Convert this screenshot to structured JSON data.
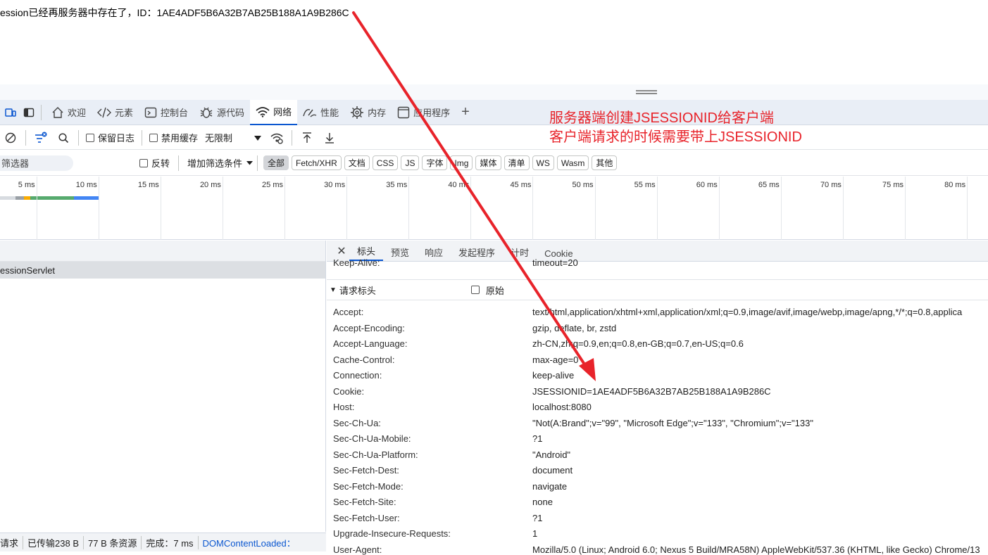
{
  "page": {
    "text": "ession已经再服务器中存在了，ID：1AE4ADF5B6A32B7AB25B188A1A9B286C"
  },
  "devtools": {
    "tabs": [
      {
        "label": "欢迎",
        "icon": "home-icon"
      },
      {
        "label": "元素",
        "icon": "code-icon"
      },
      {
        "label": "控制台",
        "icon": "console-icon"
      },
      {
        "label": "源代码",
        "icon": "bug-icon"
      },
      {
        "label": "网络",
        "icon": "wifi-icon",
        "active": true
      },
      {
        "label": "性能",
        "icon": "performance-icon"
      },
      {
        "label": "内存",
        "icon": "memory-icon"
      },
      {
        "label": "应用程序",
        "icon": "application-icon"
      }
    ],
    "add_tab": "+"
  },
  "toolbar": {
    "preserve_log": "保留日志",
    "disable_cache": "禁用缓存",
    "throttle": "无限制"
  },
  "filter": {
    "placeholder": "筛选器",
    "invert": "反转",
    "more_filters": "增加筛选条件",
    "chips": [
      "全部",
      "Fetch/XHR",
      "文档",
      "CSS",
      "JS",
      "字体",
      "Img",
      "媒体",
      "清单",
      "WS",
      "Wasm",
      "其他"
    ]
  },
  "timeline": {
    "ticks": [
      "5 ms",
      "10 ms",
      "15 ms",
      "20 ms",
      "25 ms",
      "30 ms",
      "35 ms",
      "40 ms",
      "45 ms",
      "50 ms",
      "55 ms",
      "60 ms",
      "65 ms",
      "70 ms",
      "75 ms",
      "80 ms"
    ]
  },
  "requests": {
    "selected": "essionServlet"
  },
  "details": {
    "tabs": [
      "标头",
      "预览",
      "响应",
      "发起程序",
      "计时",
      "Cookie"
    ],
    "partial_row": {
      "key": "Keep-Alive:",
      "value": "timeout=20"
    },
    "section_title": "请求标头",
    "raw_label": "原始",
    "headers": [
      {
        "key": "Accept:",
        "value": "text/html,application/xhtml+xml,application/xml;q=0.9,image/avif,image/webp,image/apng,*/*;q=0.8,applica"
      },
      {
        "key": "Accept-Encoding:",
        "value": "gzip, deflate, br, zstd"
      },
      {
        "key": "Accept-Language:",
        "value": "zh-CN,zh;q=0.9,en;q=0.8,en-GB;q=0.7,en-US;q=0.6"
      },
      {
        "key": "Cache-Control:",
        "value": "max-age=0"
      },
      {
        "key": "Connection:",
        "value": "keep-alive"
      },
      {
        "key": "Cookie:",
        "value": "JSESSIONID=1AE4ADF5B6A32B7AB25B188A1A9B286C"
      },
      {
        "key": "Host:",
        "value": "localhost:8080"
      },
      {
        "key": "Sec-Ch-Ua:",
        "value": "\"Not(A:Brand\";v=\"99\", \"Microsoft Edge\";v=\"133\", \"Chromium\";v=\"133\""
      },
      {
        "key": "Sec-Ch-Ua-Mobile:",
        "value": "?1"
      },
      {
        "key": "Sec-Ch-Ua-Platform:",
        "value": "\"Android\""
      },
      {
        "key": "Sec-Fetch-Dest:",
        "value": "document"
      },
      {
        "key": "Sec-Fetch-Mode:",
        "value": "navigate"
      },
      {
        "key": "Sec-Fetch-Site:",
        "value": "none"
      },
      {
        "key": "Sec-Fetch-User:",
        "value": "?1"
      },
      {
        "key": "Upgrade-Insecure-Requests:",
        "value": "1"
      },
      {
        "key": "User-Agent:",
        "value": "Mozilla/5.0 (Linux; Android 6.0; Nexus 5 Build/MRA58N) AppleWebKit/537.36 (KHTML, like Gecko) Chrome/13"
      }
    ]
  },
  "status": {
    "requests": "请求",
    "transferred": "已传输238 B",
    "resources": "77 B 条资源",
    "finish": "完成：7 ms",
    "dcl": "DOMContentLoaded："
  },
  "annotation": {
    "line1": "服务器端创建JSESSIONID给客户端",
    "line2": "客户端请求的时候需要带上JSESSIONID"
  },
  "colors": {
    "accent": "#0b57d0",
    "annotation": "#e8232a"
  }
}
